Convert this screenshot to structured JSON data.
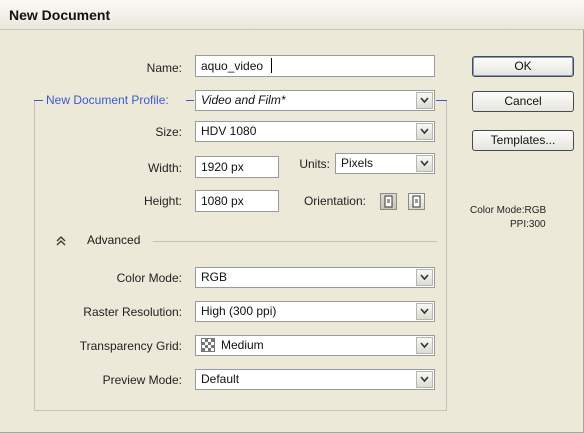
{
  "window": {
    "title": "New Document"
  },
  "form": {
    "name_label": "Name:",
    "name_value": "aquo_video",
    "profile_label": "New Document Profile:",
    "profile_value": "Video and Film*",
    "size_label": "Size:",
    "size_value": "HDV 1080",
    "width_label": "Width:",
    "width_value": "1920 px",
    "units_label": "Units:",
    "units_value": "Pixels",
    "height_label": "Height:",
    "height_value": "1080 px",
    "orientation_label": "Orientation:"
  },
  "advanced": {
    "toggle_label": "Advanced",
    "color_mode_label": "Color Mode:",
    "color_mode_value": "RGB",
    "raster_label": "Raster Resolution:",
    "raster_value": "High (300 ppi)",
    "transparency_label": "Transparency Grid:",
    "transparency_value": "Medium",
    "preview_label": "Preview Mode:",
    "preview_value": "Default"
  },
  "buttons": {
    "ok": "OK",
    "cancel": "Cancel",
    "templates": "Templates..."
  },
  "info": {
    "color_mode": "Color Mode:RGB",
    "ppi": "PPI:300"
  },
  "colors": {
    "dialog_bg": "#ece9d8",
    "profile_accent": "#3a5bd0"
  },
  "icons": {
    "dropdown": "chevron-down-icon",
    "advanced_toggle": "double-chevron-up-icon",
    "portrait": "portrait-orientation-icon",
    "landscape": "landscape-orientation-icon",
    "transparency": "checkerboard-icon"
  }
}
